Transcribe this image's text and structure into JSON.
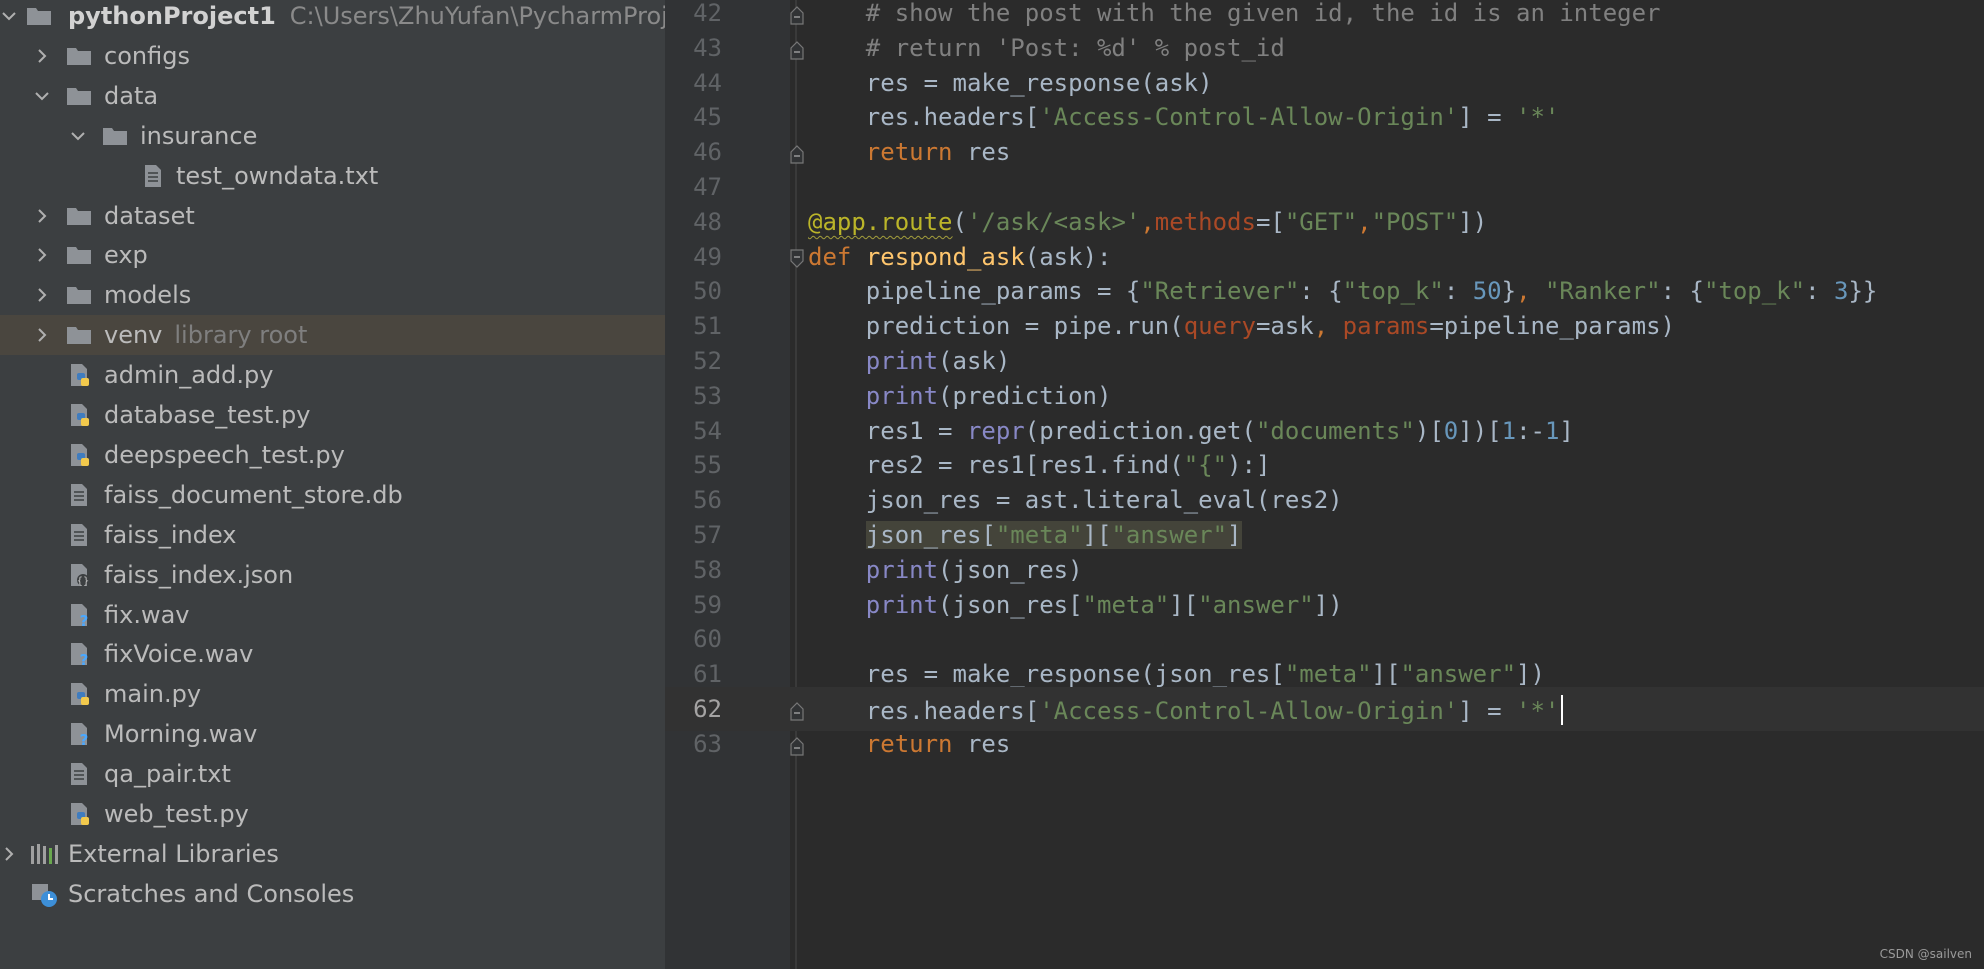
{
  "project_tree": {
    "root": {
      "name": "pythonProject1",
      "path": "C:\\Users\\ZhuYufan\\PycharmProjec"
    },
    "items": [
      {
        "label": "configs",
        "type": "folder",
        "expanded": false,
        "icon": "folder-icon"
      },
      {
        "label": "data",
        "type": "folder",
        "expanded": true,
        "icon": "folder-icon"
      },
      {
        "label": "insurance",
        "type": "folder",
        "expanded": true,
        "icon": "folder-icon"
      },
      {
        "label": "test_owndata.txt",
        "type": "file",
        "icon": "text-file-icon"
      },
      {
        "label": "dataset",
        "type": "folder",
        "expanded": false,
        "icon": "folder-icon"
      },
      {
        "label": "exp",
        "type": "folder",
        "expanded": false,
        "icon": "folder-icon"
      },
      {
        "label": "models",
        "type": "folder",
        "expanded": false,
        "icon": "folder-icon"
      },
      {
        "label": "venv",
        "suffix": "library root",
        "type": "folder",
        "expanded": false,
        "selected": true,
        "icon": "folder-icon"
      },
      {
        "label": "admin_add.py",
        "type": "file",
        "icon": "python-file-icon"
      },
      {
        "label": "database_test.py",
        "type": "file",
        "icon": "python-file-icon"
      },
      {
        "label": "deepspeech_test.py",
        "type": "file",
        "icon": "python-file-icon"
      },
      {
        "label": "faiss_document_store.db",
        "type": "file",
        "icon": "text-file-icon"
      },
      {
        "label": "faiss_index",
        "type": "file",
        "icon": "text-file-icon"
      },
      {
        "label": "faiss_index.json",
        "type": "file",
        "icon": "json-file-icon"
      },
      {
        "label": "fix.wav",
        "type": "file",
        "icon": "unknown-file-icon"
      },
      {
        "label": "fixVoice.wav",
        "type": "file",
        "icon": "unknown-file-icon"
      },
      {
        "label": "main.py",
        "type": "file",
        "icon": "python-file-icon"
      },
      {
        "label": "Morning.wav",
        "type": "file",
        "icon": "unknown-file-icon"
      },
      {
        "label": "qa_pair.txt",
        "type": "file",
        "icon": "text-file-icon"
      },
      {
        "label": "web_test.py",
        "type": "file",
        "icon": "python-file-icon"
      },
      {
        "label": "External Libraries",
        "type": "libraries",
        "expanded": false,
        "icon": "libraries-icon"
      },
      {
        "label": "Scratches and Consoles",
        "type": "scratches",
        "icon": "scratches-icon"
      }
    ]
  },
  "editor": {
    "current_line": "62",
    "lines": [
      {
        "num": "42",
        "tokens": [
          [
            "    # show the post with the given id, the id is an integer",
            "comment"
          ]
        ]
      },
      {
        "num": "43",
        "tokens": [
          [
            "    # return 'Post: %d' % post_id",
            "comment"
          ]
        ]
      },
      {
        "num": "44",
        "tokens": [
          [
            "    res = make_response(ask)",
            "normal"
          ]
        ]
      },
      {
        "num": "45",
        "tokens": [
          [
            "    res.headers[",
            "normal"
          ],
          [
            "'Access-Control-Allow-Origin'",
            "string"
          ],
          [
            "] = ",
            "normal"
          ],
          [
            "'*'",
            "string"
          ]
        ]
      },
      {
        "num": "46",
        "tokens": [
          [
            "    ",
            "normal"
          ],
          [
            "return",
            "keyword"
          ],
          [
            " res",
            "normal"
          ]
        ]
      },
      {
        "num": "47",
        "tokens": []
      },
      {
        "num": "48",
        "tokens": [
          [
            "@app.route",
            "decorator"
          ],
          [
            "(",
            "normal"
          ],
          [
            "'/ask/<ask>'",
            "string"
          ],
          [
            ",",
            "keyword"
          ],
          [
            "methods",
            "param"
          ],
          [
            "=[",
            "normal"
          ],
          [
            "\"GET\"",
            "string"
          ],
          [
            ",",
            "keyword"
          ],
          [
            "\"POST\"",
            "string"
          ],
          [
            "])",
            "normal"
          ]
        ]
      },
      {
        "num": "49",
        "tokens": [
          [
            "def",
            "keyword"
          ],
          [
            " ",
            "normal"
          ],
          [
            "respond_ask",
            "func"
          ],
          [
            "(ask):",
            "normal"
          ]
        ]
      },
      {
        "num": "50",
        "tokens": [
          [
            "    pipeline_params = {",
            "normal"
          ],
          [
            "\"Retriever\"",
            "string"
          ],
          [
            ": {",
            "normal"
          ],
          [
            "\"top_k\"",
            "string"
          ],
          [
            ": ",
            "normal"
          ],
          [
            "50",
            "number"
          ],
          [
            "}",
            "normal"
          ],
          [
            ", ",
            "keyword"
          ],
          [
            "\"Ranker\"",
            "string"
          ],
          [
            ": {",
            "normal"
          ],
          [
            "\"top_k\"",
            "string"
          ],
          [
            ": ",
            "normal"
          ],
          [
            "3",
            "number"
          ],
          [
            "}}",
            "normal"
          ]
        ]
      },
      {
        "num": "51",
        "tokens": [
          [
            "    prediction = pipe.run(",
            "normal"
          ],
          [
            "query",
            "param"
          ],
          [
            "=ask",
            "normal"
          ],
          [
            ", ",
            "keyword"
          ],
          [
            "params",
            "param"
          ],
          [
            "=pipeline_params)",
            "normal"
          ]
        ]
      },
      {
        "num": "52",
        "tokens": [
          [
            "    ",
            "normal"
          ],
          [
            "print",
            "builtin"
          ],
          [
            "(ask)",
            "normal"
          ]
        ]
      },
      {
        "num": "53",
        "tokens": [
          [
            "    ",
            "normal"
          ],
          [
            "print",
            "builtin"
          ],
          [
            "(prediction)",
            "normal"
          ]
        ]
      },
      {
        "num": "54",
        "tokens": [
          [
            "    res1 = ",
            "normal"
          ],
          [
            "repr",
            "builtin"
          ],
          [
            "(prediction.get(",
            "normal"
          ],
          [
            "\"documents\"",
            "string"
          ],
          [
            ")[",
            "normal"
          ],
          [
            "0",
            "number"
          ],
          [
            "])[",
            "normal"
          ],
          [
            "1",
            "number"
          ],
          [
            ":-",
            "normal"
          ],
          [
            "1",
            "number"
          ],
          [
            "]",
            "normal"
          ]
        ]
      },
      {
        "num": "55",
        "tokens": [
          [
            "    res2 = res1[res1.find(",
            "normal"
          ],
          [
            "\"{\"",
            "string"
          ],
          [
            "):]",
            "normal"
          ]
        ]
      },
      {
        "num": "56",
        "tokens": [
          [
            "    json_res = ast.literal_eval(res2)",
            "normal"
          ]
        ]
      },
      {
        "num": "57",
        "tokens": [
          [
            "    ",
            "normal"
          ],
          [
            "json_res[",
            "hl-normal"
          ],
          [
            "\"meta\"",
            "hl-string"
          ],
          [
            "][",
            "hl-normal"
          ],
          [
            "\"answer\"",
            "hl-string"
          ],
          [
            "]",
            "hl-normal"
          ]
        ]
      },
      {
        "num": "58",
        "tokens": [
          [
            "    ",
            "normal"
          ],
          [
            "print",
            "builtin"
          ],
          [
            "(json_res)",
            "normal"
          ]
        ]
      },
      {
        "num": "59",
        "tokens": [
          [
            "    ",
            "normal"
          ],
          [
            "print",
            "builtin"
          ],
          [
            "(json_res[",
            "normal"
          ],
          [
            "\"meta\"",
            "string"
          ],
          [
            "][",
            "normal"
          ],
          [
            "\"answer\"",
            "string"
          ],
          [
            "])",
            "normal"
          ]
        ]
      },
      {
        "num": "60",
        "tokens": []
      },
      {
        "num": "61",
        "tokens": [
          [
            "    res = make_response(json_res[",
            "normal"
          ],
          [
            "\"meta\"",
            "string"
          ],
          [
            "][",
            "normal"
          ],
          [
            "\"answer\"",
            "string"
          ],
          [
            "])",
            "normal"
          ]
        ]
      },
      {
        "num": "62",
        "tokens": [
          [
            "    res.headers[",
            "normal"
          ],
          [
            "'Access-Control-Allow-Origin'",
            "string"
          ],
          [
            "] = ",
            "normal"
          ],
          [
            "'*'",
            "string"
          ]
        ]
      },
      {
        "num": "63",
        "tokens": [
          [
            "    ",
            "normal"
          ],
          [
            "return",
            "keyword"
          ],
          [
            " res",
            "normal"
          ]
        ]
      }
    ]
  },
  "watermark": "CSDN @sailven",
  "colors": {
    "tree_bg": "#3c3f41",
    "editor_bg": "#2b2b2b",
    "selection": "#4a463f",
    "keyword": "#cc7832",
    "string": "#6a8759",
    "number": "#6897bb",
    "comment": "#808080",
    "function": "#ffc66d",
    "builtin": "#8888c6",
    "decorator": "#bbb529",
    "parameter": "#aa4926"
  }
}
